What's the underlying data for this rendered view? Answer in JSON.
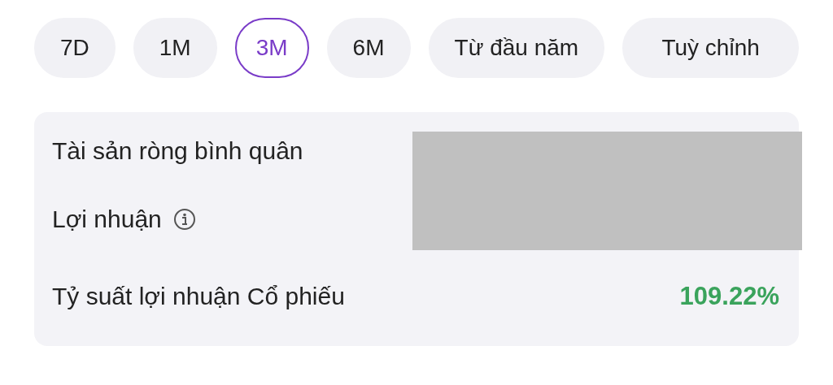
{
  "periods": [
    {
      "label": "7D",
      "selected": false
    },
    {
      "label": "1M",
      "selected": false
    },
    {
      "label": "3M",
      "selected": true
    },
    {
      "label": "6M",
      "selected": false
    },
    {
      "label": "Từ đầu năm",
      "selected": false
    },
    {
      "label": "Tuỳ chỉnh",
      "selected": false
    }
  ],
  "summary": {
    "rows": [
      {
        "label": "Tài sản ròng bình quân",
        "info": false
      },
      {
        "label": "Lợi nhuận",
        "info": true
      },
      {
        "label": "Tỷ suất lợi nhuận Cổ phiếu",
        "info": false,
        "value": "109.22%"
      }
    ],
    "redacted": true
  }
}
